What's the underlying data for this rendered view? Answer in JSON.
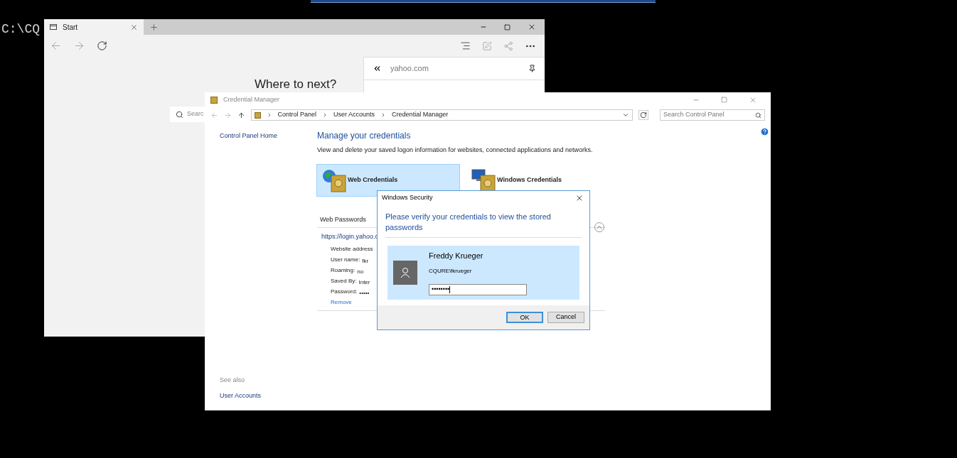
{
  "console": {
    "text": "C:\\CQ"
  },
  "browser": {
    "tab": {
      "label": "Start"
    },
    "heading": "Where to next?",
    "search": {
      "placeholder": "Searc"
    },
    "hub": {
      "address": "yahoo.com"
    }
  },
  "credential_manager": {
    "title": "Credential Manager",
    "breadcrumb": [
      "Control Panel",
      "User Accounts",
      "Credential Manager"
    ],
    "search": {
      "placeholder": "Search Control Panel"
    },
    "sidebar": {
      "home": "Control Panel Home",
      "see_also": "See also",
      "links": [
        "User Accounts"
      ]
    },
    "heading": "Manage your credentials",
    "description": "View and delete your saved logon information for websites, connected applications and networks.",
    "tiles": [
      {
        "label": "Web Credentials",
        "selected": true,
        "kind": "web"
      },
      {
        "label": "Windows Credentials",
        "selected": false,
        "kind": "windows"
      }
    ],
    "section": "Web Passwords",
    "entry": {
      "url": "https://login.yahoo.c",
      "expanded": true,
      "details": [
        {
          "label": "Website address"
        },
        {
          "label": "User name:",
          "value": "fkr"
        },
        {
          "label": "Roaming:",
          "value": "no"
        },
        {
          "label": "Saved By:",
          "value": "Inter"
        },
        {
          "label": "Password:",
          "value": "•••••"
        }
      ],
      "remove": "Remove"
    }
  },
  "dialog": {
    "title": "Windows Security",
    "message": "Please verify your credentials to view the stored passwords",
    "account": {
      "name": "Freddy Krueger",
      "user": "CQURE\\fkrueger",
      "selected": true,
      "password": "••••••••"
    },
    "buttons": [
      {
        "label": "OK",
        "default": true
      },
      {
        "label": "Cancel",
        "default": false
      }
    ]
  }
}
